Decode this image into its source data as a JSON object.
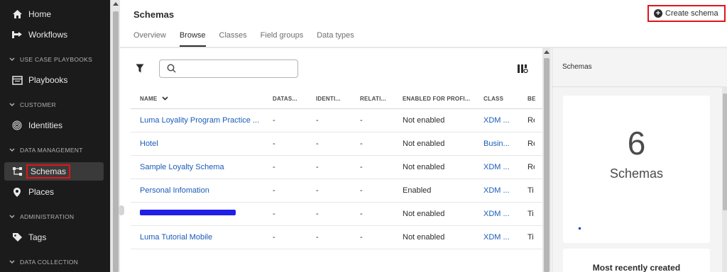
{
  "sidebar": {
    "home": "Home",
    "workflows": "Workflows",
    "section_playbooks": "USE CASE PLAYBOOKS",
    "playbooks": "Playbooks",
    "section_customer": "CUSTOMER",
    "identities": "Identities",
    "section_data_management": "DATA MANAGEMENT",
    "schemas": "Schemas",
    "places": "Places",
    "section_administration": "ADMINISTRATION",
    "tags": "Tags",
    "section_data_collection": "DATA COLLECTION"
  },
  "header": {
    "title": "Schemas",
    "create_button": "Create schema",
    "tabs": [
      "Overview",
      "Browse",
      "Classes",
      "Field groups",
      "Data types"
    ],
    "active_tab": "Browse"
  },
  "search": {
    "value": "",
    "placeholder": ""
  },
  "table": {
    "columns": [
      "NAME",
      "DATAS...",
      "IDENTI...",
      "RELATI...",
      "ENABLED FOR PROFI...",
      "CLASS",
      "BE"
    ],
    "rows": [
      {
        "name": "Luma Loyality Program Practice ...",
        "datasets": "-",
        "identities": "-",
        "relationships": "-",
        "profile": "Not enabled",
        "class": "XDM ...",
        "behavior": "Re"
      },
      {
        "name": "Hotel",
        "datasets": "-",
        "identities": "-",
        "relationships": "-",
        "profile": "Not enabled",
        "class": "Busin...",
        "behavior": "Re"
      },
      {
        "name": "Sample Loyalty Schema",
        "datasets": "-",
        "identities": "-",
        "relationships": "-",
        "profile": "Not enabled",
        "class": "XDM ...",
        "behavior": "Re"
      },
      {
        "name": "Personal Infomation",
        "datasets": "-",
        "identities": "-",
        "relationships": "-",
        "profile": "Enabled",
        "class": "XDM ...",
        "behavior": "Ti"
      },
      {
        "name": "",
        "datasets": "-",
        "identities": "-",
        "relationships": "-",
        "profile": "Not enabled",
        "class": "XDM ...",
        "behavior": "Ti"
      },
      {
        "name": "Luma Tutorial Mobile",
        "datasets": "-",
        "identities": "-",
        "relationships": "-",
        "profile": "Not enabled",
        "class": "XDM ...",
        "behavior": "Ti"
      }
    ]
  },
  "panel": {
    "title": "Schemas",
    "count": "6",
    "count_label": "Schemas",
    "recent_title": "Most recently created"
  },
  "colors": {
    "sidebar_bg": "#1b1b1b",
    "link": "#1a5bb8",
    "highlight": "#e0141b"
  }
}
